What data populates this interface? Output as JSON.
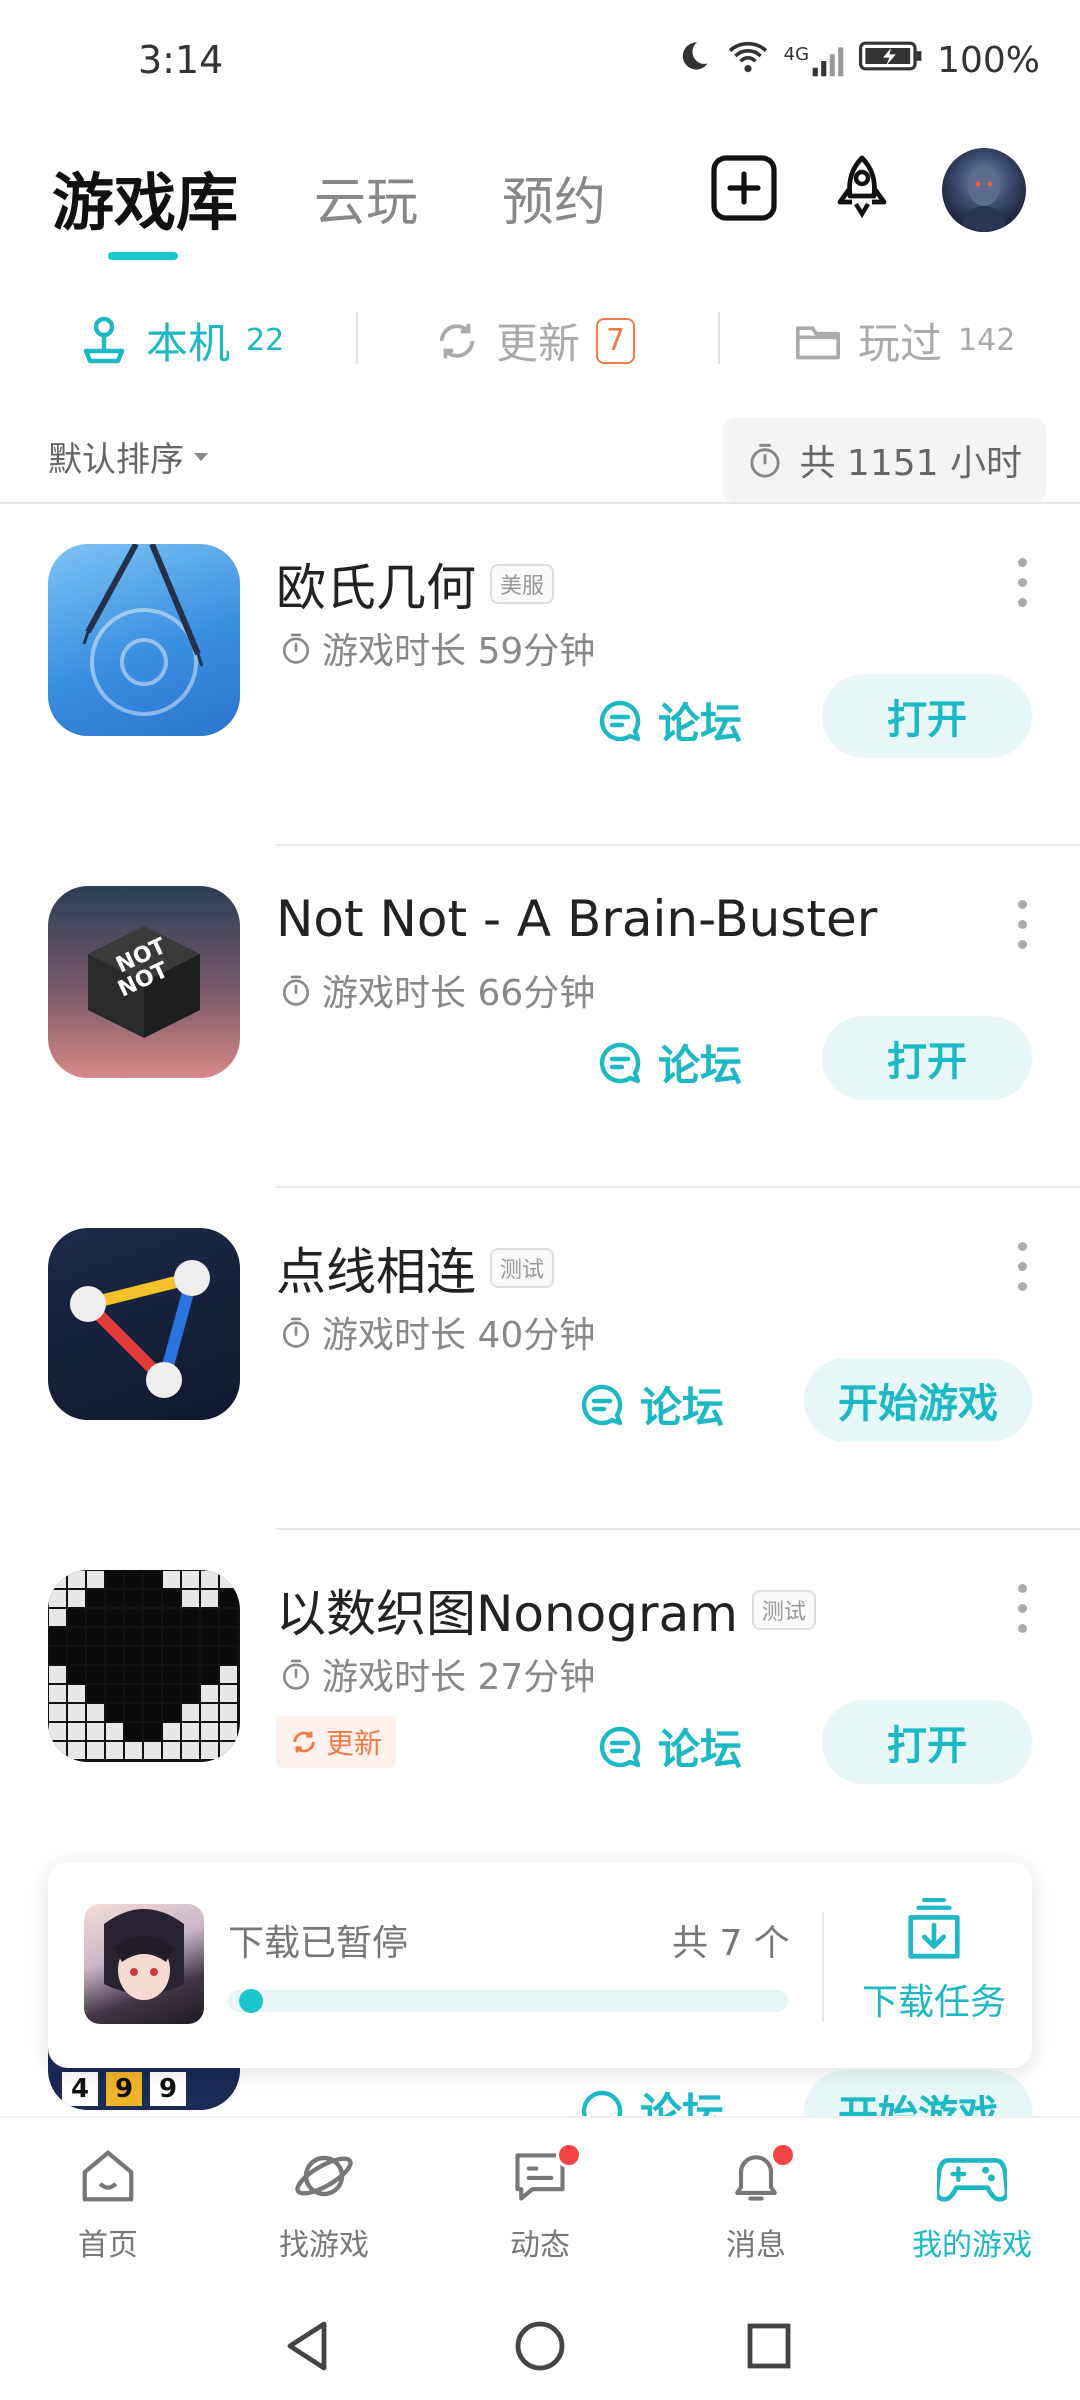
{
  "status_bar": {
    "time": "3:14",
    "battery": "100%",
    "signal_label": "4G"
  },
  "header": {
    "tabs": [
      "游戏库",
      "云玩",
      "预约"
    ],
    "active_tab": 0
  },
  "subtabs": {
    "local": {
      "label": "本机",
      "count": "22"
    },
    "update": {
      "label": "更新",
      "count": "7"
    },
    "played": {
      "label": "玩过",
      "count": "142"
    }
  },
  "sort": {
    "label": "默认排序"
  },
  "total": {
    "label": "共 1151 小时"
  },
  "games": [
    {
      "title": "欧氏几何",
      "tag": "美服",
      "playtime": "游戏时长 59分钟",
      "forum": "论坛",
      "action": "打开",
      "update": ""
    },
    {
      "title": "Not Not - A Brain-Buster",
      "tag": "",
      "playtime": "游戏时长 66分钟",
      "forum": "论坛",
      "action": "打开",
      "update": ""
    },
    {
      "title": "点线相连",
      "tag": "测试",
      "playtime": "游戏时长 40分钟",
      "forum": "论坛",
      "action": "开始游戏",
      "update": ""
    },
    {
      "title": "以数织图Nonogram",
      "tag": "测试",
      "playtime": "游戏时长 27分钟",
      "forum": "论坛",
      "action": "打开",
      "update": "更新"
    }
  ],
  "peek": {
    "forum": "论坛",
    "action": "开始游戏",
    "digits": [
      "4",
      "9",
      "9"
    ]
  },
  "download": {
    "status": "下载已暂停",
    "count": "共 7 个",
    "task_label": "下载任务",
    "progress": 0.02
  },
  "bottom_nav": [
    "首页",
    "找游戏",
    "动态",
    "消息",
    "我的游戏"
  ],
  "colors": {
    "accent": "#1cc4cc",
    "update": "#f07a48",
    "badge": "#f34545"
  }
}
